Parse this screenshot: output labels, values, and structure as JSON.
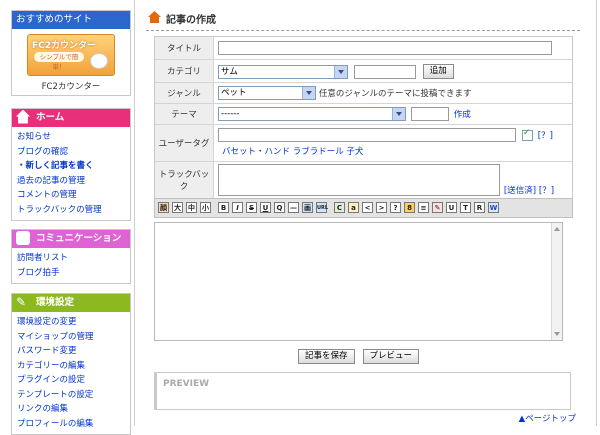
{
  "sidebar": {
    "recommend": {
      "title": "おすすめのサイト",
      "banner_title": "FC2カウンター",
      "banner_sub": "シンプルで簡単！",
      "label": "FC2カウンター"
    },
    "home": {
      "title": "ホーム",
      "items": [
        "お知らせ",
        "ブログの確認",
        "・新しく記事を書く",
        "過去の記事の管理",
        "コメントの管理",
        "トラックバックの管理"
      ]
    },
    "communication": {
      "title": "コミュニケーション",
      "items": [
        "訪問者リスト",
        "ブログ拍手"
      ]
    },
    "settings": {
      "title": "環境設定",
      "items": [
        "環境設定の変更",
        "マイショップの管理",
        "パスワード変更",
        "カテゴリーの編集",
        "プラグインの設定",
        "テンプレートの設定",
        "リンクの編集",
        "プロフィールの編集"
      ]
    }
  },
  "page": {
    "title": "記事の作成"
  },
  "form": {
    "title_label": "タイトル",
    "title_value": "",
    "category_label": "カテゴリ",
    "category_value": "サム",
    "category_new_value": "",
    "add_button": "追加",
    "genre_label": "ジャンル",
    "genre_value": "ペット",
    "genre_note": "任意のジャンルのテーマに投稿できます",
    "theme_label": "テーマ",
    "theme_value": "------",
    "theme_new_value": "",
    "create_link": "作成",
    "usertag_label": "ユーザータグ",
    "usertag_value": "",
    "usertag_help": "[？]",
    "usertag_suggestions": "バセット・ハンド ラブラドール 子犬",
    "trackback_label": "トラックバック",
    "trackback_value": "",
    "trackback_sent": "[送信済]",
    "trackback_help": "[？]"
  },
  "toolbar": {
    "buttons": [
      "顔",
      "大",
      "中",
      "小",
      "B",
      "I",
      "S",
      "U",
      "Q",
      "—",
      "画",
      "URL",
      "C",
      "a",
      "<",
      ">",
      "?",
      "8",
      "≡",
      "✎",
      "U",
      "T",
      "R",
      "W"
    ]
  },
  "editor": {
    "body_value": ""
  },
  "actions": {
    "save": "記事を保存",
    "preview": "プレビュー"
  },
  "preview": {
    "label": "PREVIEW"
  },
  "footer": {
    "page_top": "▲ページトップ"
  },
  "colors": {
    "recommend": "#2b66cc",
    "home": "#e8307a",
    "communication": "#e063d6",
    "settings": "#8cb820",
    "link": "#0033cc"
  },
  "icons": {
    "title": "house-icon",
    "home": "home-icon",
    "communication": "people-icon",
    "settings": "wrench-icon"
  }
}
